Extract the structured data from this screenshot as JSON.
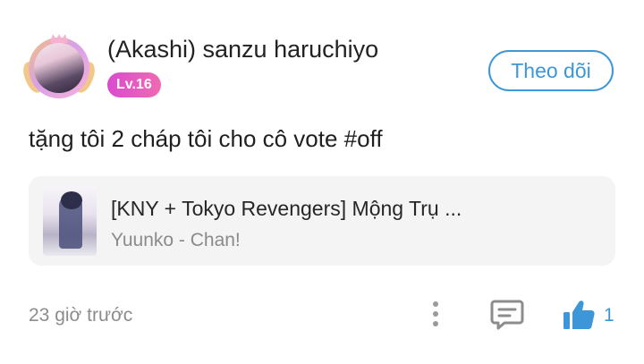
{
  "post": {
    "username": "(Akashi) sanzu haruchiyo",
    "level_badge": "Lv.16",
    "follow_label": "Theo dõi",
    "comment_text": "tặng tôi 2 cháp tôi cho cô vote #off",
    "time": "23 giờ trước",
    "like_count": "1"
  },
  "story": {
    "title": "[KNY + Tokyo Revengers] Mộng Trụ ...",
    "author": "Yuunko - Chan!"
  },
  "icons": {
    "more": "more-vertical-icon",
    "comment": "comment-icon",
    "like": "thumbs-up-icon"
  },
  "colors": {
    "accent": "#3d96d8",
    "badge": "#e458c4",
    "card_bg": "#f4f4f4"
  }
}
